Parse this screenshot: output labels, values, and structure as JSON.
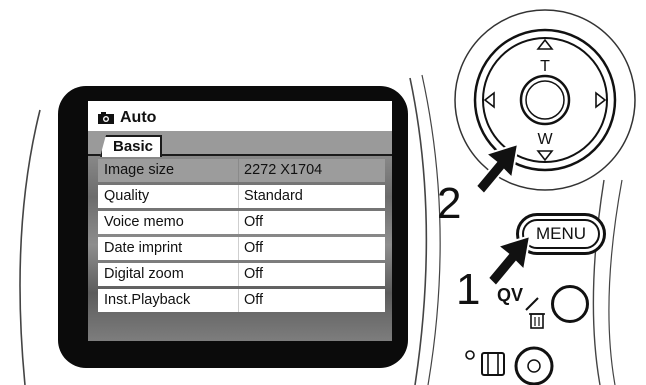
{
  "lcd": {
    "mode_label": "Auto",
    "tab_label": "Basic",
    "menu_rows": [
      {
        "label": "Image size",
        "value": "2272 X1704",
        "selected": true
      },
      {
        "label": "Quality",
        "value": "Standard",
        "selected": false
      },
      {
        "label": "Voice memo",
        "value": "Off",
        "selected": false
      },
      {
        "label": "Date imprint",
        "value": "Off",
        "selected": false
      },
      {
        "label": "Digital zoom",
        "value": "Off",
        "selected": false
      },
      {
        "label": "Inst.Playback",
        "value": "Off",
        "selected": false
      }
    ]
  },
  "controls": {
    "zoom_tele_label": "T",
    "zoom_wide_label": "W",
    "step_two_number": "2",
    "step_one_number": "1",
    "menu_button_label": "MENU",
    "qv_label": "QV"
  }
}
